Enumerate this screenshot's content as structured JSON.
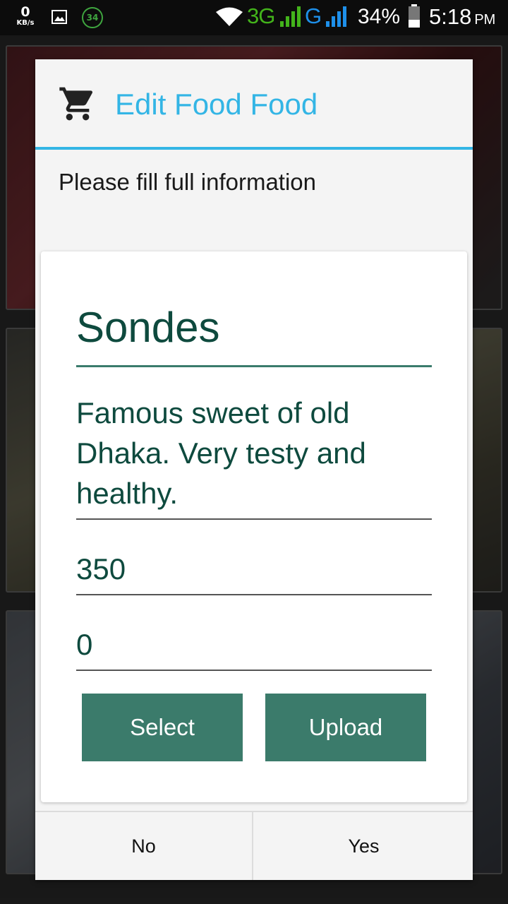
{
  "status_bar": {
    "net_speed": "0",
    "net_unit": "KB/s",
    "notif_count": "34",
    "network_type_1": "3G",
    "network_type_2": "G",
    "battery": "34%",
    "time": "5:18",
    "ampm": "PM"
  },
  "dialog": {
    "title": "Edit Food Food",
    "message": "Please fill full information",
    "form": {
      "name": "Sondes",
      "description": "Famous sweet of old Dhaka. Very testy and healthy.",
      "price": "350",
      "quantity": "0",
      "select_label": "Select",
      "upload_label": "Upload"
    },
    "no_label": "No",
    "yes_label": "Yes"
  },
  "colors": {
    "accent": "#33b5e5",
    "button": "#3b7b6b",
    "field_text": "#0e4a3e"
  }
}
